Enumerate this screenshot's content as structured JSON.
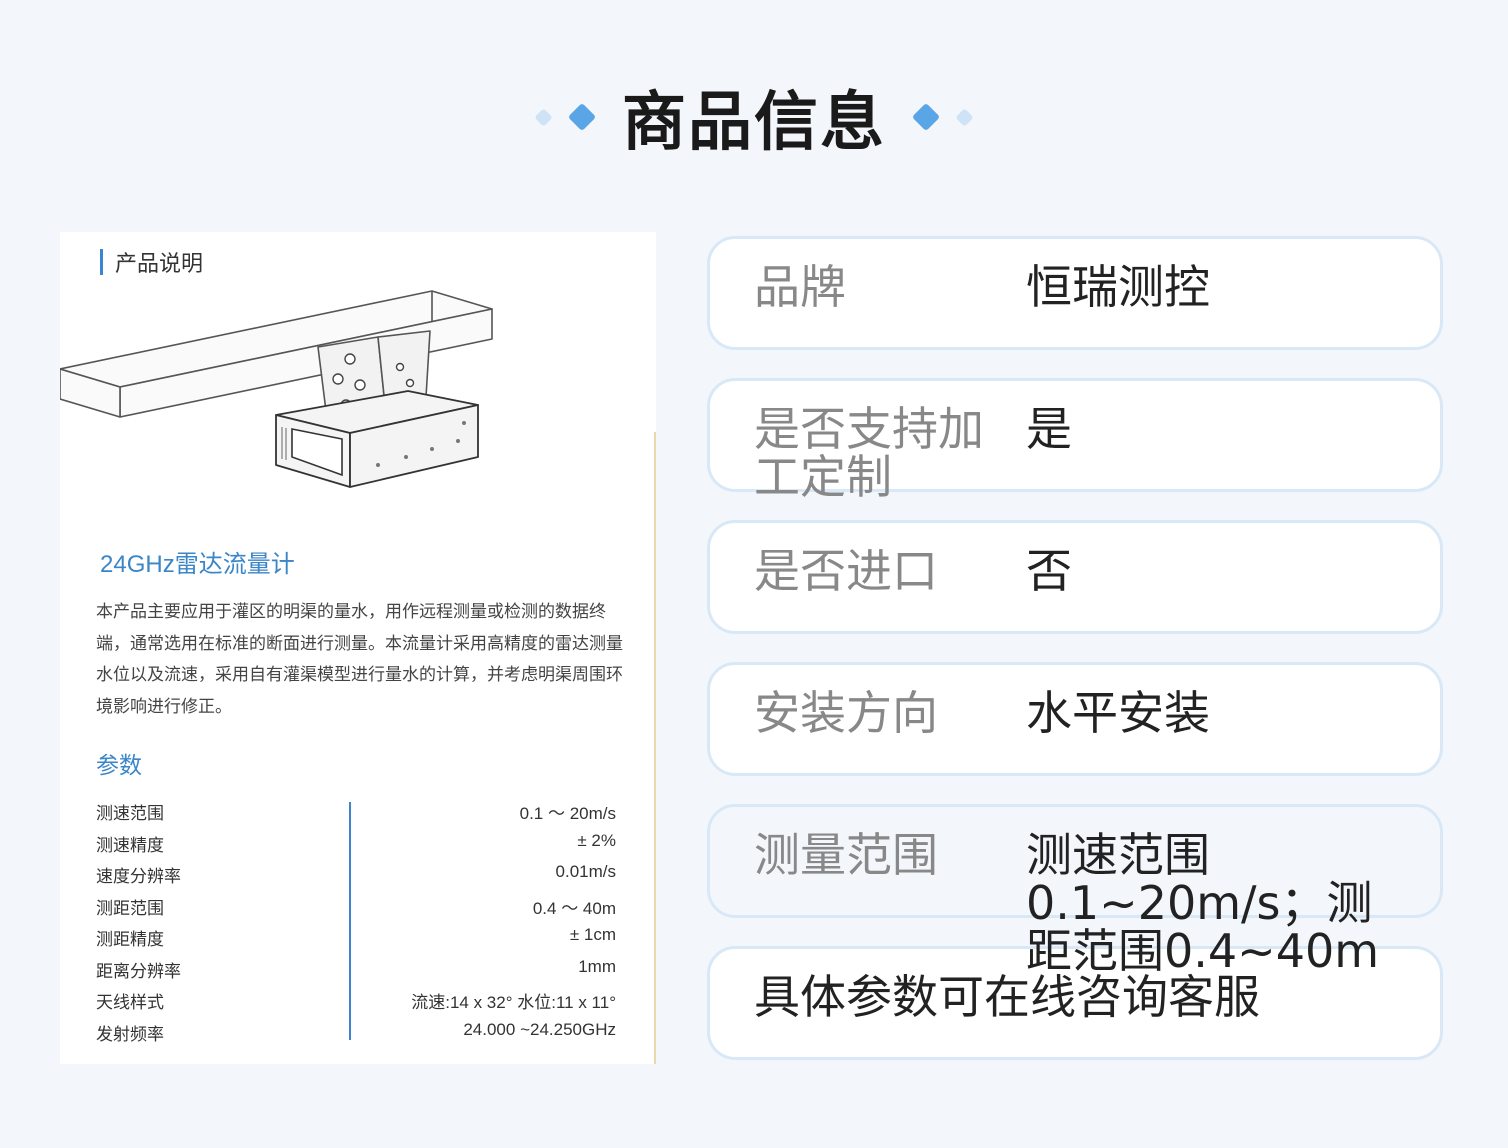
{
  "header": {
    "title": "商品信息"
  },
  "doc": {
    "section_title": "产品说明",
    "product_name": "24GHz雷达流量计",
    "description": "本产品主要应用于灌区的明渠的量水，用作远程测量或检测的数据终端，通常选用在标准的断面进行测量。本流量计采用高精度的雷达测量水位以及流速，采用自有灌渠模型进行量水的计算，并考虑明渠周围环境影响进行修正。",
    "params_title": "参数",
    "params": [
      {
        "key": "测速范围",
        "value": "0.1 ～ 20m/s"
      },
      {
        "key": "测速精度",
        "value": "± 2%"
      },
      {
        "key": "速度分辨率",
        "value": "0.01m/s"
      },
      {
        "key": "测距范围",
        "value": "0.4 ～ 40m"
      },
      {
        "key": "测距精度",
        "value": "± 1cm"
      },
      {
        "key": "距离分辨率",
        "value": "1mm"
      },
      {
        "key": "天线样式",
        "value": "流速:14 x 32°  水位:11 x 11°"
      },
      {
        "key": "发射频率",
        "value": "24.000 ~24.250GHz"
      }
    ]
  },
  "info": {
    "rows": [
      {
        "label": "品牌",
        "value": "恒瑞测控"
      },
      {
        "label": "是否支持加工定制",
        "value": "是"
      },
      {
        "label": "是否进口",
        "value": "否"
      },
      {
        "label": "安装方向",
        "value": "水平安装"
      },
      {
        "label": "测量范围",
        "value": "测速范围0.1~20m/s；测距范围0.4~40m"
      }
    ],
    "footer_note": "具体参数可在线咨询客服"
  },
  "colors": {
    "accent": "#3a86c8",
    "card_border": "#d9e8f7",
    "background": "#f3f7fc"
  }
}
